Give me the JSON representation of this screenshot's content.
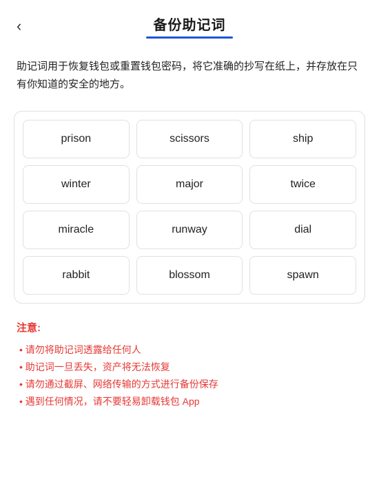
{
  "header": {
    "back_label": "‹",
    "title": "备份助记词"
  },
  "description": "助记词用于恢复钱包或重置钱包密码，将它准确的抄写在纸上，并存放在只有你知道的安全的地方。",
  "mnemonic_grid": {
    "words": [
      "prison",
      "scissors",
      "ship",
      "winter",
      "major",
      "twice",
      "miracle",
      "runway",
      "dial",
      "rabbit",
      "blossom",
      "spawn"
    ]
  },
  "notice": {
    "title": "注意:",
    "items": [
      "请勿将助记词透露给任何人",
      "助记词一旦丢失，资产将无法恢复",
      "请勿通过截屏、网络传输的方式进行备份保存",
      "遇到任何情况，请不要轻易卸载钱包 App"
    ]
  }
}
